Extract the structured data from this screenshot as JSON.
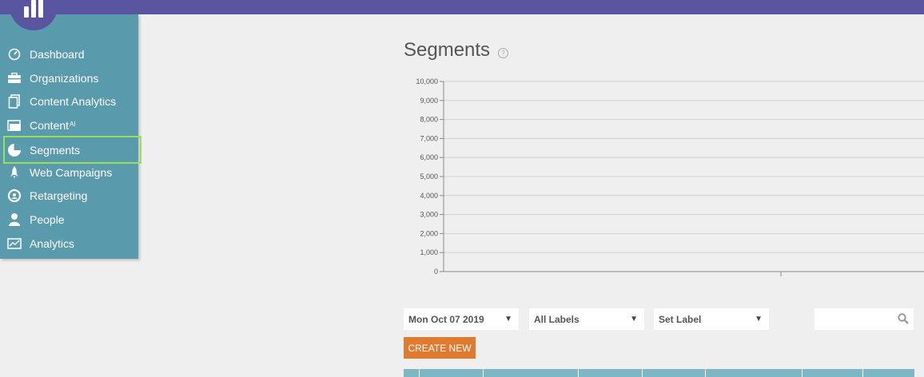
{
  "sidebar": {
    "items": [
      {
        "label": "Dashboard",
        "icon": "dashboard-gauge-icon"
      },
      {
        "label": "Organizations",
        "icon": "briefcase-icon"
      },
      {
        "label": "Content Analytics",
        "icon": "documents-icon"
      },
      {
        "label": "Content",
        "sup": "AI",
        "icon": "content-folder-icon"
      },
      {
        "label": "Segments",
        "icon": "pie-chart-icon",
        "active": true
      },
      {
        "label": "Web Campaigns",
        "icon": "rocket-icon"
      },
      {
        "label": "Retargeting",
        "icon": "retargeting-icon"
      },
      {
        "label": "People",
        "icon": "person-icon"
      },
      {
        "label": "Analytics",
        "icon": "analytics-chart-icon"
      }
    ]
  },
  "page": {
    "title": "Segments",
    "help": "?"
  },
  "chart_data": {
    "type": "line",
    "y_ticks": [
      "10,000",
      "9,000",
      "8,000",
      "7,000",
      "6,000",
      "5,000",
      "4,000",
      "3,000",
      "2,000",
      "1,000",
      "0"
    ],
    "ylim": [
      0,
      10000
    ],
    "grid": true,
    "series": []
  },
  "controls": {
    "date_select": "Mon Oct 07 2019",
    "labels_select": "All Labels",
    "set_label_select": "Set Label",
    "search_value": "",
    "create_button": "CREATE NEW"
  },
  "colors": {
    "topbar": "#5a55a0",
    "sidebar": "#5a9aad",
    "active_outline": "#9bde57",
    "create_button": "#e07a2e",
    "table_header": "#7fb6c6"
  }
}
